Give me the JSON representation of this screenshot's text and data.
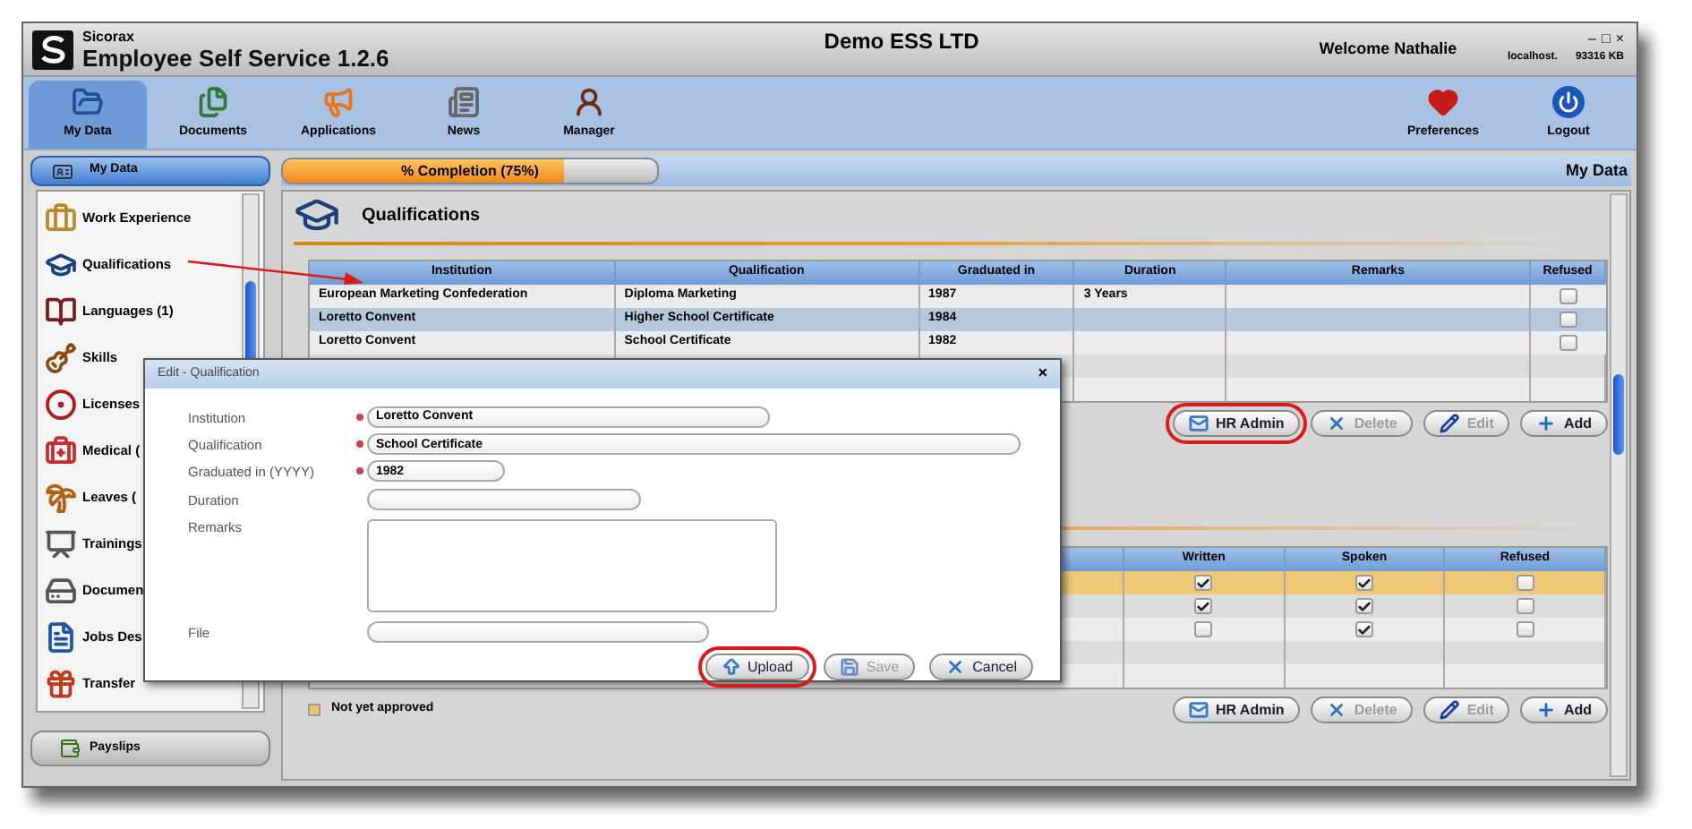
{
  "window": {
    "brand": "Sicorax",
    "title": "Employee Self Service 1.2.6",
    "company": "Demo ESS LTD",
    "welcome": "Welcome Nathalie",
    "controls": [
      "–",
      "□",
      "×"
    ],
    "host": "localhost.",
    "memory": "93316 KB"
  },
  "toolbar": [
    {
      "label": "My Data",
      "kind": "folder",
      "selected": true
    },
    {
      "label": "Documents",
      "kind": "files",
      "selected": false
    },
    {
      "label": "Applications",
      "kind": "megaphone",
      "selected": false
    },
    {
      "label": "News",
      "kind": "news",
      "selected": false
    },
    {
      "label": "Manager",
      "kind": "person",
      "selected": false
    }
  ],
  "toolbar_right": [
    {
      "label": "Preferences",
      "kind": "heart"
    },
    {
      "label": "Logout",
      "kind": "power"
    }
  ],
  "sidebar": {
    "header": "My Data",
    "items": [
      {
        "label": "Work Experience",
        "kind": "work"
      },
      {
        "label": "Qualifications",
        "kind": "grad"
      },
      {
        "label": "Languages (1)",
        "kind": "book"
      },
      {
        "label": "Skills",
        "kind": "guitar"
      },
      {
        "label": "Licenses",
        "kind": "wheel"
      },
      {
        "label": "Medical (",
        "kind": "medical"
      },
      {
        "label": "Leaves (",
        "kind": "leaves"
      },
      {
        "label": "Trainings",
        "kind": "training"
      },
      {
        "label": "Documen",
        "kind": "drive"
      },
      {
        "label": "Jobs Des",
        "kind": "jobs"
      },
      {
        "label": "Transfer",
        "kind": "gift"
      }
    ],
    "footer": "Payslips"
  },
  "progress": {
    "label": "% Completion (75%)",
    "level": 0.75
  },
  "breadcrumb": "My Data",
  "qualifications": {
    "title": "Qualifications",
    "columns": [
      "Institution",
      "Qualification",
      "Graduated in",
      "Duration",
      "Remarks",
      "Refused"
    ],
    "rows": [
      {
        "cells": [
          "European Marketing Confederation",
          "Diploma Marketing",
          "1987",
          "3 Years",
          ""
        ],
        "refused": false,
        "selected": false
      },
      {
        "cells": [
          "Loretto Convent",
          "Higher School Certificate",
          "1984",
          "",
          ""
        ],
        "refused": false,
        "selected": true
      },
      {
        "cells": [
          "Loretto Convent",
          "School Certificate",
          "1982",
          "",
          ""
        ],
        "refused": false,
        "selected": false
      }
    ],
    "buttons": [
      {
        "label": "HR Admin",
        "kind": "hr",
        "disabled": false,
        "highlighted": true
      },
      {
        "label": "Delete",
        "kind": "delete",
        "disabled": true,
        "highlighted": false
      },
      {
        "label": "Edit",
        "kind": "edit",
        "disabled": true,
        "highlighted": false
      },
      {
        "label": "Add",
        "kind": "add",
        "disabled": false,
        "highlighted": false
      }
    ]
  },
  "languages": {
    "columns": [
      "Written",
      "Spoken",
      "Refused"
    ],
    "rows": [
      {
        "written": true,
        "spoken": true,
        "refused": false,
        "selected": true
      },
      {
        "written": true,
        "spoken": true,
        "refused": false,
        "selected": false
      },
      {
        "written": false,
        "spoken": true,
        "refused": false,
        "selected": false
      }
    ],
    "legend": {
      "label": "Not yet approved",
      "color": "#e8c86a"
    },
    "buttons": [
      {
        "label": "HR Admin",
        "kind": "hr",
        "disabled": false,
        "highlighted": false
      },
      {
        "label": "Delete",
        "kind": "delete",
        "disabled": true,
        "highlighted": false
      },
      {
        "label": "Edit",
        "kind": "edit",
        "disabled": true,
        "highlighted": false
      },
      {
        "label": "Add",
        "kind": "add",
        "disabled": false,
        "highlighted": false
      }
    ]
  },
  "dialog": {
    "title": "Edit - Qualification",
    "close": "×",
    "fields": [
      {
        "label": "Institution",
        "required": true,
        "value": "Loretto Convent",
        "kind": "text"
      },
      {
        "label": "Qualification",
        "required": true,
        "value": "School Certificate",
        "kind": "text"
      },
      {
        "label": "Graduated in (YYYY)",
        "required": true,
        "value": "1982",
        "kind": "text"
      },
      {
        "label": "Duration",
        "required": false,
        "kind": "text"
      },
      {
        "label": "Remarks",
        "required": false,
        "kind": "area"
      },
      {
        "label": "File",
        "required": false,
        "kind": "text"
      }
    ],
    "buttons": [
      {
        "label": "Upload",
        "kind": "upload",
        "disabled": false,
        "highlighted": true
      },
      {
        "label": "Save",
        "kind": "save",
        "disabled": true,
        "highlighted": false
      },
      {
        "label": "Cancel",
        "kind": "cancel",
        "disabled": false,
        "highlighted": false
      }
    ]
  }
}
